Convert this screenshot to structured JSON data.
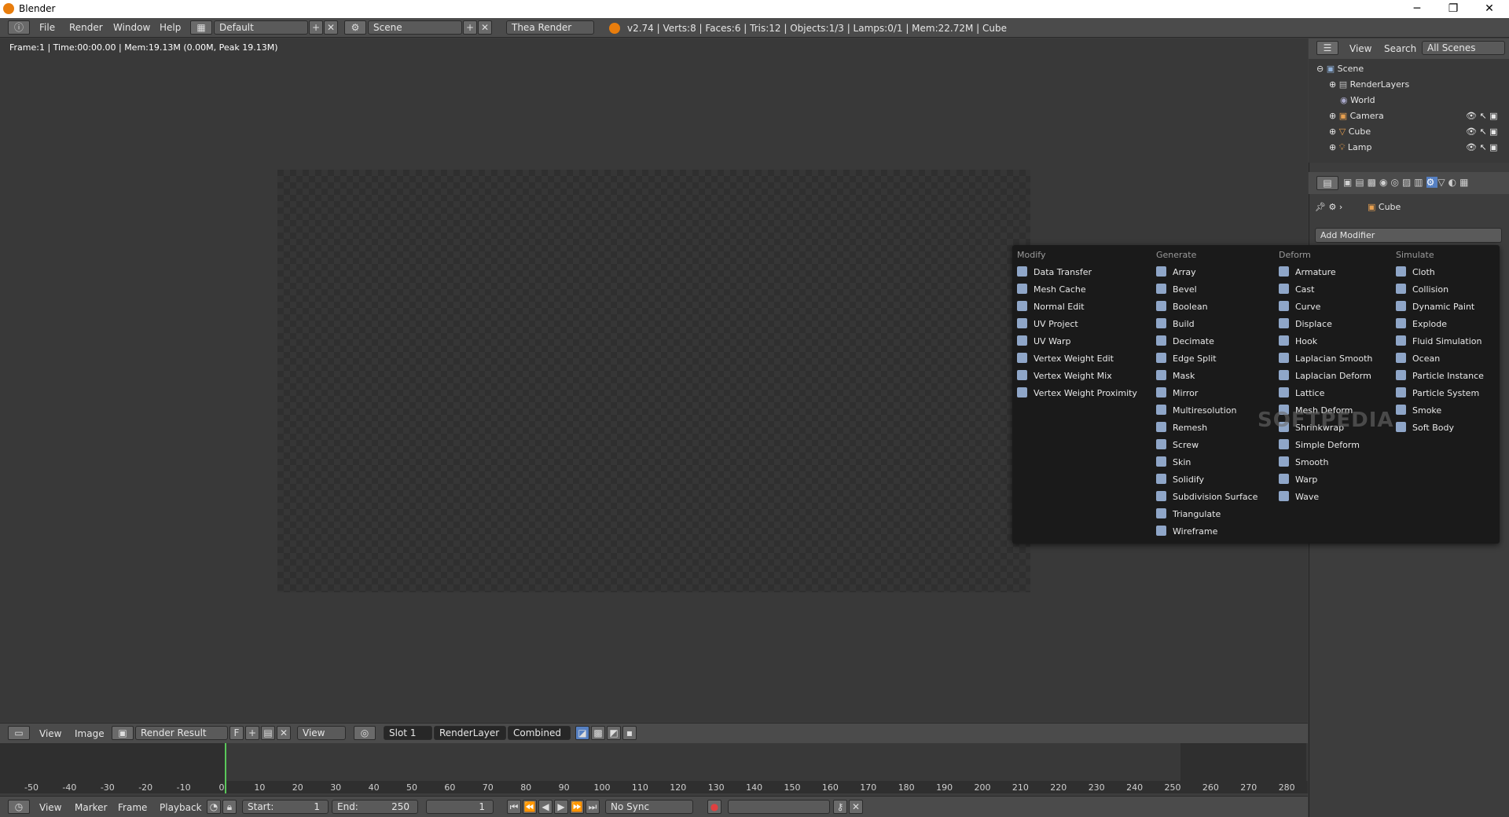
{
  "window": {
    "title": "Blender",
    "controls": [
      "─",
      "❐",
      "✕"
    ]
  },
  "infobar": {
    "menus": [
      "File",
      "Render",
      "Window",
      "Help"
    ],
    "screen_layout": "Default",
    "scene": "Scene",
    "render_engine": "Thea Render",
    "stats": "v2.74 | Verts:8 | Faces:6 | Tris:12 | Objects:1/3 | Lamps:0/1 | Mem:22.72M | Cube"
  },
  "image_editor": {
    "frame_info": "Frame:1 | Time:00:00.00 | Mem:19.13M (0.00M, Peak 19.13M)",
    "header": {
      "menus": [
        "View",
        "Image"
      ],
      "image_name": "Render Result",
      "f_label": "F",
      "view_mode": "View",
      "slot": "Slot 1",
      "render_layer": "RenderLayer",
      "pass": "Combined"
    }
  },
  "timeline": {
    "ruler": [
      "-50",
      "-40",
      "-30",
      "-20",
      "-10",
      "0",
      "10",
      "20",
      "30",
      "40",
      "50",
      "60",
      "70",
      "80",
      "90",
      "100",
      "110",
      "120",
      "130",
      "140",
      "150",
      "160",
      "170",
      "180",
      "190",
      "200",
      "210",
      "220",
      "230",
      "240",
      "250",
      "260",
      "270",
      "280"
    ],
    "header_menus": [
      "View",
      "Marker",
      "Frame",
      "Playback"
    ],
    "start_label": "Start:",
    "start_value": "1",
    "end_label": "End:",
    "end_value": "250",
    "current_frame": "1",
    "sync": "No Sync"
  },
  "outliner": {
    "header": {
      "view": "View",
      "search": "Search",
      "filter": "All Scenes"
    },
    "items": [
      {
        "label": "Scene",
        "icon": "scene-icon"
      },
      {
        "label": "RenderLayers",
        "icon": "renderlayers-icon"
      },
      {
        "label": "World",
        "icon": "world-icon"
      },
      {
        "label": "Camera",
        "icon": "camera-icon"
      },
      {
        "label": "Cube",
        "icon": "mesh-icon"
      },
      {
        "label": "Lamp",
        "icon": "lamp-icon"
      }
    ]
  },
  "properties": {
    "context_object": "Cube",
    "add_modifier_label": "Add Modifier"
  },
  "modifier_menu": {
    "columns": [
      {
        "title": "Modify",
        "items": [
          "Data Transfer",
          "Mesh Cache",
          "Normal Edit",
          "UV Project",
          "UV Warp",
          "Vertex Weight Edit",
          "Vertex Weight Mix",
          "Vertex Weight Proximity"
        ]
      },
      {
        "title": "Generate",
        "items": [
          "Array",
          "Bevel",
          "Boolean",
          "Build",
          "Decimate",
          "Edge Split",
          "Mask",
          "Mirror",
          "Multiresolution",
          "Remesh",
          "Screw",
          "Skin",
          "Solidify",
          "Subdivision Surface",
          "Triangulate",
          "Wireframe"
        ]
      },
      {
        "title": "Deform",
        "items": [
          "Armature",
          "Cast",
          "Curve",
          "Displace",
          "Hook",
          "Laplacian Smooth",
          "Laplacian Deform",
          "Lattice",
          "Mesh Deform",
          "Shrinkwrap",
          "Simple Deform",
          "Smooth",
          "Warp",
          "Wave"
        ]
      },
      {
        "title": "Simulate",
        "items": [
          "Cloth",
          "Collision",
          "Dynamic Paint",
          "Explode",
          "Fluid Simulation",
          "Ocean",
          "Particle Instance",
          "Particle System",
          "Smoke",
          "Soft Body"
        ]
      }
    ]
  },
  "watermark": "SOFTPEDIA",
  "colors": {
    "accent": "#5680c2",
    "playhead": "#5ac85a"
  }
}
